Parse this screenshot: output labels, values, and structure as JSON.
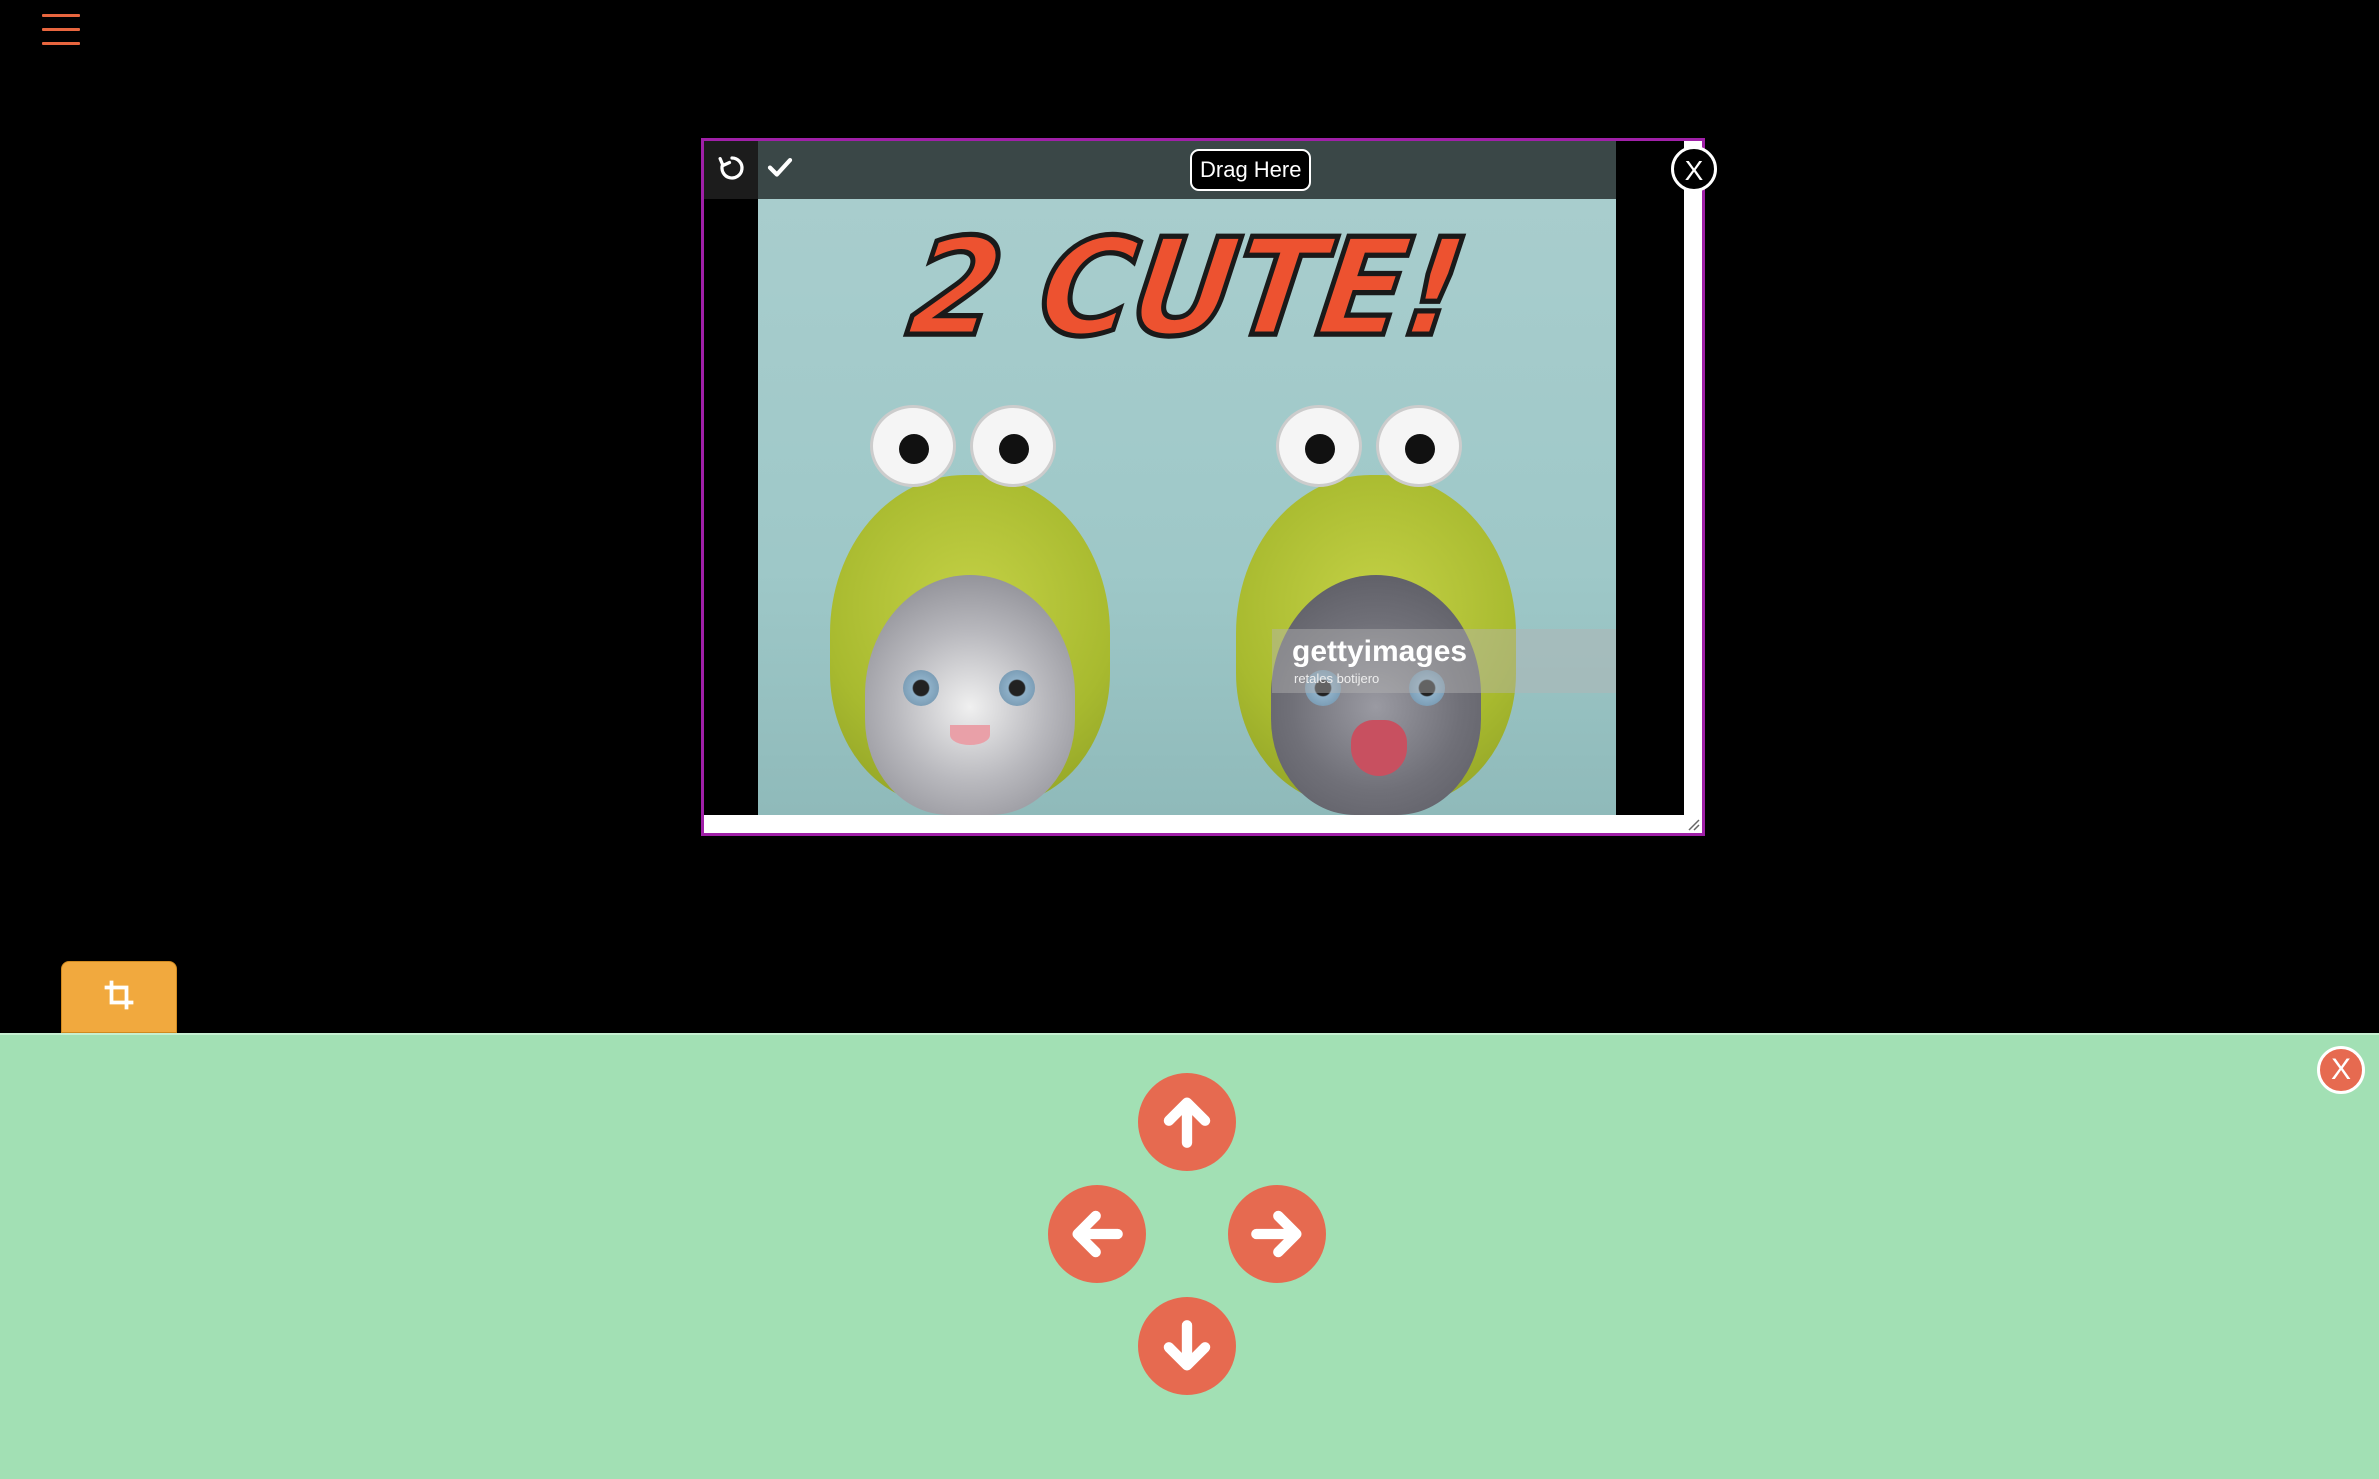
{
  "menu": {
    "icon": "hamburger-menu-icon"
  },
  "viewer": {
    "drag_label": "Drag Here",
    "close_label": "X",
    "rotate_icon": "rotate-icon",
    "confirm_icon": "checkmark-icon",
    "image": {
      "title_text": "2 CUTE!",
      "watermark_main": "gettyimages",
      "watermark_sub": "retales botijero"
    }
  },
  "crop_tab": {
    "icon": "crop-icon"
  },
  "panel": {
    "close_label": "X",
    "arrows": [
      "up-arrow-icon",
      "left-arrow-icon",
      "right-arrow-icon",
      "down-arrow-icon"
    ]
  },
  "colors": {
    "accent": "#e66a50",
    "panel_bg": "#a2e0b4",
    "crop_tab": "#f1a93e",
    "viewer_border": "#a020a8"
  }
}
